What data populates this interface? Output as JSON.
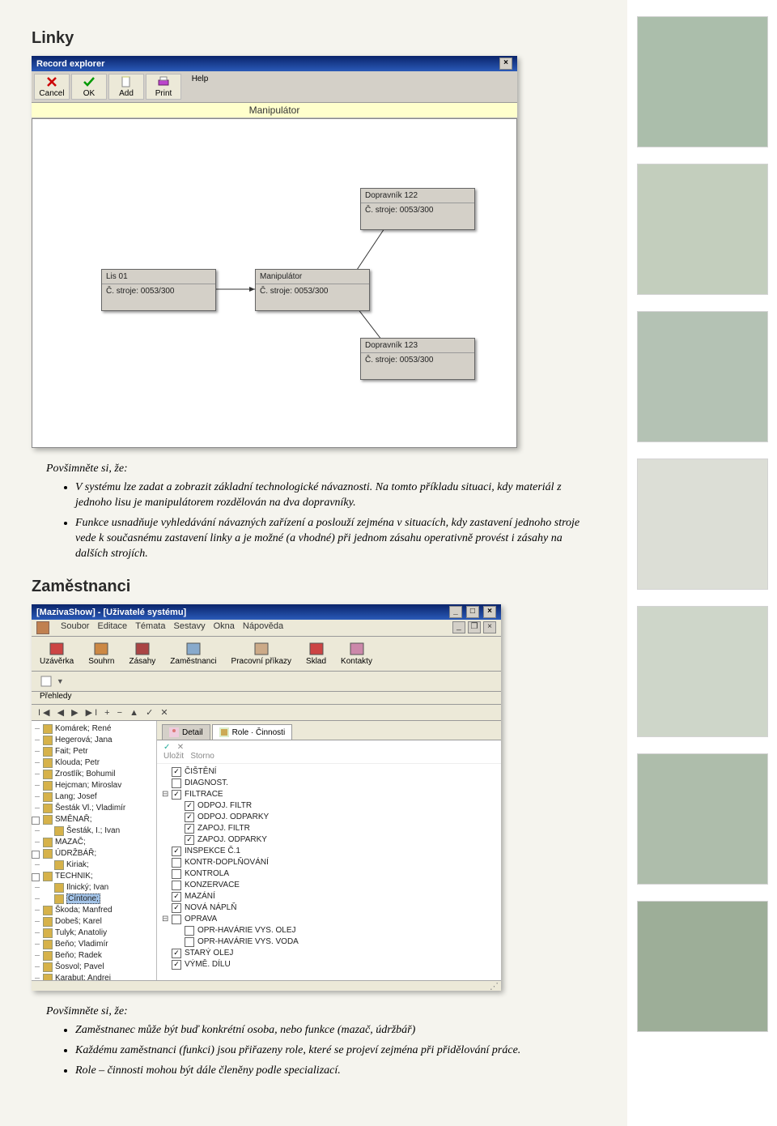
{
  "section1_title": "Linky",
  "section2_title": "Zaměstnanci",
  "note_intro": "Povšimněte si, že:",
  "notes1": [
    "V systému lze zadat a zobrazit základní technologické návaznosti. Na tomto příkladu situaci, kdy materiál z jednoho lisu je manipulátorem rozdělován na dva dopravníky.",
    "Funkce usnadňuje vyhledávání návazných zařízení a poslouží zejména v situacích, kdy zastavení jednoho stroje vede k současnému zastavení linky a je možné (a vhodné) při jednom zásahu operativně provést i zásahy na dalších strojích."
  ],
  "notes2": [
    "Zaměstnanec může být buď konkrétní osoba, nebo funkce (mazač, údržbář)",
    "Každému zaměstnanci (funkci) jsou přiřazeny role, které se projeví zejména při přidělování práce.",
    "Role – činnosti mohou být dále členěny podle specializací."
  ],
  "record_explorer": {
    "title": "Record explorer",
    "toolbar": [
      "Cancel",
      "OK",
      "Add",
      "Print",
      "Help"
    ],
    "diagram_title": "Manipulátor",
    "nodes": {
      "lis": {
        "t": "Lis 01",
        "b": "Č. stroje: 0053/300"
      },
      "man": {
        "t": "Manipulátor",
        "b": "Č. stroje: 0053/300"
      },
      "d122": {
        "t": "Dopravník 122",
        "b": "Č. stroje: 0053/300"
      },
      "d123": {
        "t": "Dopravník 123",
        "b": "Č. stroje: 0053/300"
      }
    }
  },
  "maziva": {
    "title": "[MazivaShow] - [Uživatelé systému]",
    "menu": [
      "Soubor",
      "Editace",
      "Témata",
      "Sestavy",
      "Okna",
      "Nápověda"
    ],
    "toolbar": [
      {
        "l": "Uzávěrka"
      },
      {
        "l": "Souhrn"
      },
      {
        "l": "Zásahy"
      },
      {
        "l": "Zaměstnanci"
      },
      {
        "l": "Pracovní příkazy"
      },
      {
        "l": "Sklad"
      },
      {
        "l": "Kontakty"
      }
    ],
    "subbar_label": "Přehledy",
    "nav": "I◀  ◀  ▶  ▶I  +  −  ▲  ✓  ✕",
    "employees": [
      {
        "t": "Komárek; René",
        "lv": 1
      },
      {
        "t": "Hegerová; Jana",
        "lv": 1
      },
      {
        "t": "Fait; Petr",
        "lv": 1
      },
      {
        "t": "Klouda; Petr",
        "lv": 1
      },
      {
        "t": "Zrostlík; Bohumil",
        "lv": 1
      },
      {
        "t": "Hejcman; Miroslav",
        "lv": 1
      },
      {
        "t": "Lang; Josef",
        "lv": 1
      },
      {
        "t": "Šesták Vl.; Vladimír",
        "lv": 1
      },
      {
        "t": "SMĚNAŘ;",
        "lv": 1,
        "exp": true
      },
      {
        "t": "Šesták, I.; Ivan",
        "lv": 2
      },
      {
        "t": "MAZAČ;",
        "lv": 1
      },
      {
        "t": "ÚDRŽBÁŘ;",
        "lv": 1,
        "exp": true
      },
      {
        "t": "Kiriak;",
        "lv": 2
      },
      {
        "t": "TECHNIK;",
        "lv": 1,
        "exp": true
      },
      {
        "t": "Ilnický; Ivan",
        "lv": 2
      },
      {
        "t": "Cíntone;",
        "lv": 2,
        "sel": true
      },
      {
        "t": "Škoda; Manfred",
        "lv": 1
      },
      {
        "t": "Dobeš; Karel",
        "lv": 1
      },
      {
        "t": "Tulyk; Anatoliy",
        "lv": 1
      },
      {
        "t": "Beňo; Vladimír",
        "lv": 1
      },
      {
        "t": "Beňo; Radek",
        "lv": 1
      },
      {
        "t": "Šosvol; Pavel",
        "lv": 1
      },
      {
        "t": "Karabut; Andrej",
        "lv": 1
      }
    ],
    "tabs": {
      "detail": "Detail",
      "role": "Role · Činnosti"
    },
    "rolebar": {
      "ok": "✓",
      "cancel": "✕",
      "apply": "Uložit",
      "storno": "Storno"
    },
    "roles": [
      {
        "t": "ČIŠTĚNÍ",
        "c": true
      },
      {
        "t": "DIAGNOST.",
        "c": false
      },
      {
        "t": "FILTRACE",
        "c": true,
        "exp": true
      },
      {
        "t": "ODPOJ. FILTR",
        "c": true,
        "lv": 2
      },
      {
        "t": "ODPOJ. ODPARKY",
        "c": true,
        "lv": 2
      },
      {
        "t": "ZAPOJ. FILTR",
        "c": true,
        "lv": 2
      },
      {
        "t": "ZAPOJ. ODPARKY",
        "c": true,
        "lv": 2
      },
      {
        "t": "INSPEKCE Č.1",
        "c": true
      },
      {
        "t": "KONTR-DOPLŇOVÁNÍ",
        "c": false
      },
      {
        "t": "KONTROLA",
        "c": false
      },
      {
        "t": "KONZERVACE",
        "c": false
      },
      {
        "t": "MAZÁNÍ",
        "c": true
      },
      {
        "t": "NOVÁ NÁPLŇ",
        "c": true
      },
      {
        "t": "OPRAVA",
        "c": false,
        "exp": true
      },
      {
        "t": "OPR-HAVÁRIE VYS. OLEJ",
        "c": false,
        "lv": 2
      },
      {
        "t": "OPR-HAVÁRIE VYS. VODA",
        "c": false,
        "lv": 2
      },
      {
        "t": "STARÝ OLEJ",
        "c": true
      },
      {
        "t": "VÝMĚ. DÍLU",
        "c": true
      }
    ]
  }
}
